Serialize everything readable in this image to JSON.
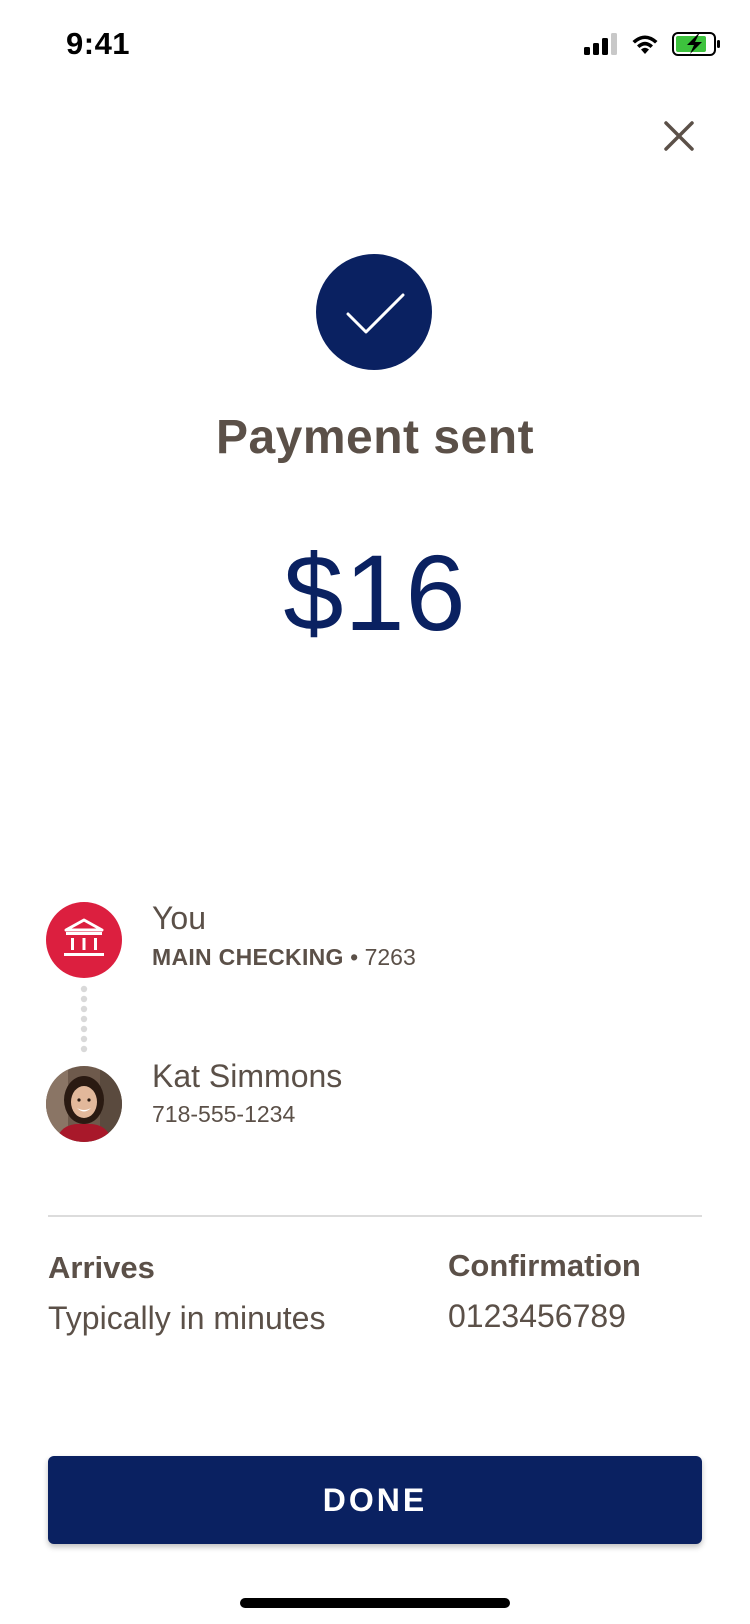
{
  "status_bar": {
    "time": "9:41",
    "signal_icon": "cellular-signal-icon",
    "wifi_icon": "wifi-icon",
    "battery_icon": "battery-charging-icon"
  },
  "header": {
    "close_icon": "close-icon"
  },
  "confirmation": {
    "check_icon": "checkmark-icon",
    "title": "Payment sent",
    "amount": "$16"
  },
  "sender": {
    "icon": "bank-icon",
    "name": "You",
    "account_label": "MAIN CHECKING",
    "separator": "•",
    "account_number": "7263"
  },
  "recipient": {
    "name": "Kat Simmons",
    "phone": "718-555-1234"
  },
  "details": {
    "arrives_label": "Arrives",
    "arrives_value": "Typically in minutes",
    "confirmation_label": "Confirmation",
    "confirmation_value": "0123456789"
  },
  "actions": {
    "done_label": "DONE"
  },
  "colors": {
    "brand_navy": "#0a2161",
    "bank_red": "#dc1f3f",
    "text_brown": "#5b5048"
  }
}
